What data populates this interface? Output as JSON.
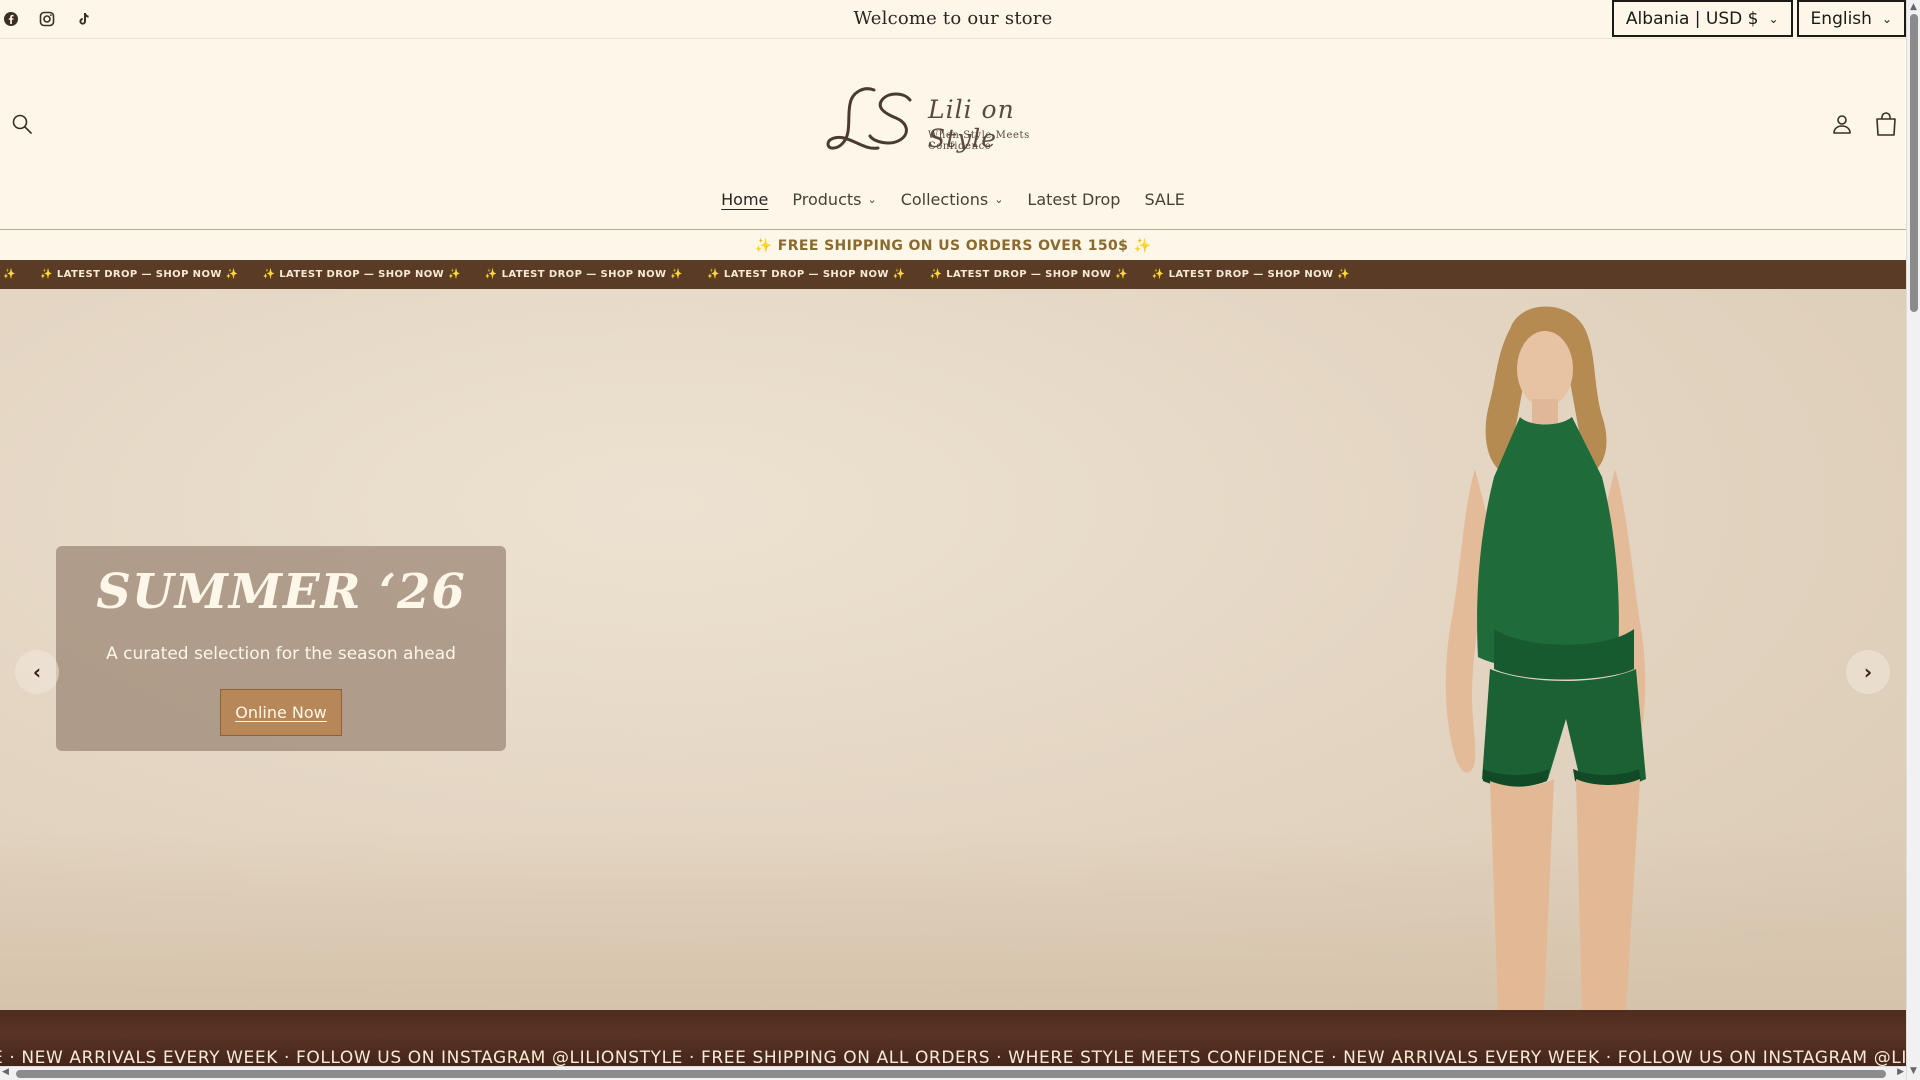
{
  "utility_bar": {
    "socials": [
      "facebook-icon",
      "instagram-icon",
      "tiktok-icon"
    ],
    "welcome_text": "Welcome to our store",
    "country_selector": "Albania | USD $",
    "language_selector": "English"
  },
  "header": {
    "logo": {
      "title": "Lili on Style",
      "tagline": "When Style Meets Confidence"
    },
    "icons": [
      "search-icon",
      "account-icon",
      "cart-icon"
    ],
    "nav": [
      {
        "label": "Home",
        "active": true,
        "dropdown": false
      },
      {
        "label": "Products",
        "active": false,
        "dropdown": true
      },
      {
        "label": "Collections",
        "active": false,
        "dropdown": true
      },
      {
        "label": "Latest Drop",
        "active": false,
        "dropdown": false
      },
      {
        "label": "SALE",
        "active": false,
        "dropdown": false
      }
    ]
  },
  "shipping_banner": "✨ FREE SHIPPING ON US ORDERS OVER 150$ ✨",
  "marquee_top": {
    "chip_text": "✨ LATEST DROP — SHOP NOW ✨",
    "lead_fragment": "W ✨"
  },
  "hero": {
    "title": "SUMMER ‘26",
    "subtitle": "A curated selection for the season ahead",
    "button_label": "Online Now",
    "prev_label": "‹",
    "next_label": "›"
  },
  "marquee_bottom": {
    "text": "E · NEW ARRIVALS EVERY WEEK · FOLLOW US ON INSTAGRAM @LILIONSTYLE · FREE SHIPPING ON ALL ORDERS · WHERE STYLE MEETS CONFIDENCE · NEW ARRIVALS EVERY WEEK · FOLLOW US ON INSTAGRAM @LILIONSTYLE · FRE"
  },
  "colors": {
    "background": "#fdf7e9",
    "marquee_brown": "#5a3b26",
    "accent_gold": "#8a6a2e",
    "cta_tan": "#b88758",
    "dress_green": "#1f6b3a"
  }
}
